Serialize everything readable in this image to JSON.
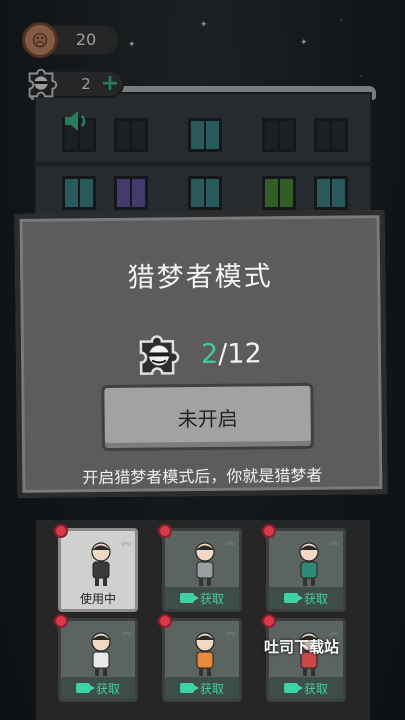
{
  "hud": {
    "coins": "20",
    "pieces": "2",
    "plus_label": "+"
  },
  "modal": {
    "title": "猎梦者模式",
    "progress_current": "2",
    "progress_separator": "/",
    "progress_total": "12",
    "status_button_label": "未开启",
    "description": "开启猎梦者模式后，你就是猎梦者"
  },
  "characters": [
    {
      "label": "使用中",
      "state": "active",
      "shirt": "#3a3a3a"
    },
    {
      "label": "获取",
      "state": "locked",
      "shirt": "#9aa0a4"
    },
    {
      "label": "获取",
      "state": "locked",
      "shirt": "#2f8a7a"
    },
    {
      "label": "获取",
      "state": "locked",
      "shirt": "#e9e9e9"
    },
    {
      "label": "获取",
      "state": "locked",
      "shirt": "#e88a3a"
    },
    {
      "label": "获取",
      "state": "locked",
      "shirt": "#c94848"
    }
  ],
  "watermark": "吐司下载站",
  "colors": {
    "accent": "#43c9a0",
    "badge": "#d83a4a"
  }
}
